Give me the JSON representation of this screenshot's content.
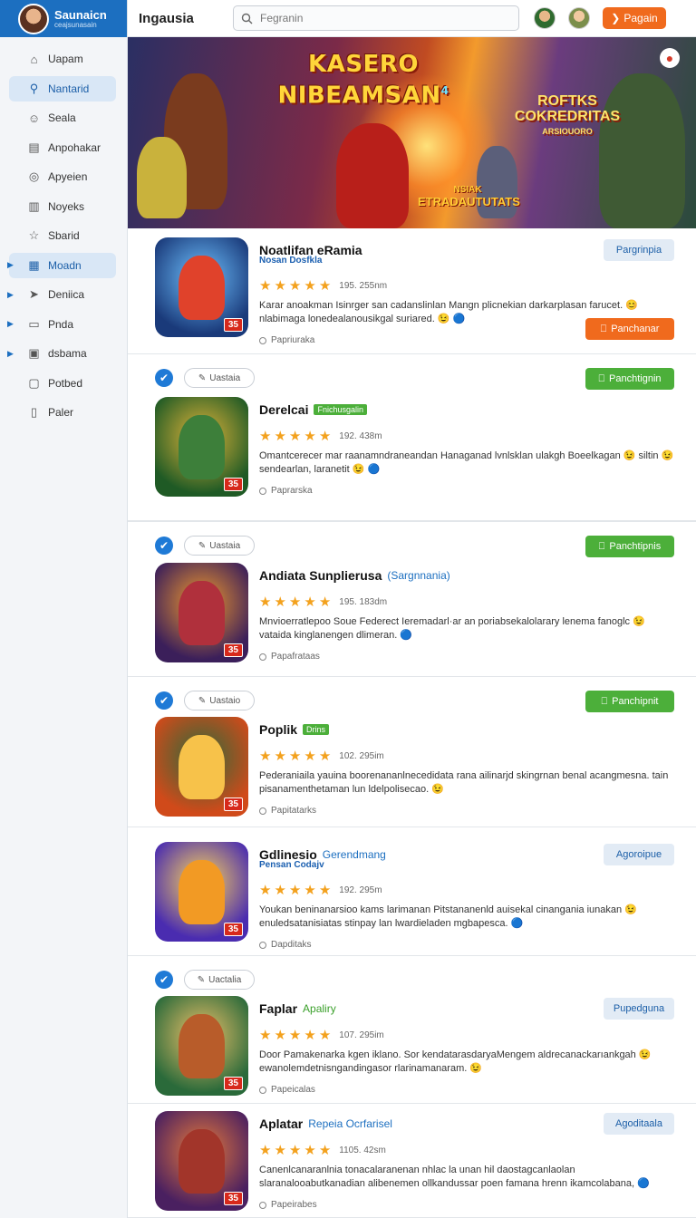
{
  "app": {
    "name": "Saunaicn",
    "subtitle": "ceajsunasain"
  },
  "header": {
    "title": "Ingausia",
    "search_placeholder": "Fegranin",
    "button": "Pagain"
  },
  "sidebar": {
    "items": [
      {
        "label": "Uapam",
        "icon": "home-icon",
        "active": false,
        "chev": false
      },
      {
        "label": "Nantarid",
        "icon": "search-icon",
        "active": true,
        "chev": false
      },
      {
        "label": "Seala",
        "icon": "user-icon",
        "active": false,
        "chev": false
      },
      {
        "label": "Anpohakar",
        "icon": "chart-icon",
        "active": false,
        "chev": false
      },
      {
        "label": "Apyeien",
        "icon": "circle-icon",
        "active": false,
        "chev": false
      },
      {
        "label": "Noyeks",
        "icon": "doc-icon",
        "active": false,
        "chev": false
      },
      {
        "label": "Sbarid",
        "icon": "star-icon",
        "active": false,
        "chev": false
      },
      {
        "label": "Moadn",
        "icon": "grid-icon",
        "active": true,
        "chev": true
      },
      {
        "label": "Deniica",
        "icon": "send-icon",
        "active": false,
        "chev": true
      },
      {
        "label": "Pnda",
        "icon": "box-icon",
        "active": false,
        "chev": true
      },
      {
        "label": "dsbama",
        "icon": "square-icon",
        "active": false,
        "chev": true
      },
      {
        "label": "Potbed",
        "icon": "folder-icon",
        "active": false,
        "chev": false
      },
      {
        "label": "Paler",
        "icon": "page-icon",
        "active": false,
        "chev": false
      }
    ]
  },
  "banner": {
    "title_line1": "KASERO",
    "title_line2": "NIBEAMSAN",
    "title_mark": "4",
    "subtitle_line1": "ROFTKS",
    "subtitle_line2": "COKREDRITAS",
    "subtitle_line3": "ARSIOUORO",
    "tag_line1": "NSIAK",
    "tag_line2": "ETRADAUTUTATS",
    "colors": {
      "title": "#ffd63a",
      "accent": "#f06a1d"
    }
  },
  "games": [
    {
      "title": "Noatlifan eRamia",
      "accent": "",
      "badge": "",
      "sub": "Nosan Dosfkla",
      "count": "195. 255nm",
      "desc": "Karar anoakman Isinrger san cadanslinlan Mangn plicnekian darkarplasan farucet. 😊 nlabimaga lonedealanousikgal suriared. 😉 🔵",
      "meta": "Papriuraka",
      "action": "Pargrinpia",
      "action2": "Panchanar",
      "checked": false,
      "tag": "",
      "thumb": "astra"
    },
    {
      "title": "Derelcai",
      "accent": "",
      "badge": "Fnichusgalin",
      "sub": "",
      "count": "192. 438m",
      "desc": "Omantcerecer mar raanamndraneandan Hanaganad lvnlsklan ulakgh Boeelkagan 😉 siltin 😉 sendearlan, laranetit 😉 🔵",
      "meta": "Paprarska",
      "action": "Panchtignin",
      "action2": "",
      "checked": true,
      "tag": "Uastaia",
      "thumb": "drara"
    },
    {
      "title": "Andiata Sunplierusa",
      "accent": "(Sargnnania)",
      "badge": "",
      "sub": "",
      "count": "195. 183dm",
      "desc": "Mnvioerratlepoo Soue Federect Ieremadarl·ar an poriabsekalolarary lenema fanoglc 😉 vataida kinglanengen dlimeran. 🔵",
      "meta": "Papafrataas",
      "action": "Panchtipnis",
      "action2": "",
      "checked": true,
      "tag": "Uastaia",
      "thumb": "hero3"
    },
    {
      "title": "Poplik",
      "accent": "",
      "badge": "Drins",
      "sub": "",
      "count": "102. 295im",
      "desc": "Pederaniaila yauina boorenananlnecedidata rana ailinarjd skingrnan benal acangmesna. tain pisanamenthetaman lun ldelpolisecao. 😉",
      "meta": "Papitatarks",
      "action": "Panchipnit",
      "action2": "",
      "checked": true,
      "tag": "Uastaio",
      "thumb": "poplik"
    },
    {
      "title": "Gdlinesio",
      "accent": "Gerendmang",
      "badge": "",
      "sub": "Pensan Codajv",
      "count": "192. 295m",
      "desc": "Youkan beninanarsioo kams larimanan Pitstananenld auisekal cinangania iunakan 😉 enuledsatanisiatas stinpay lan lwardieladen mgbapesca. 🔵",
      "meta": "Dapditaks",
      "action": "Agoroipue",
      "action2": "",
      "checked": false,
      "tag": "",
      "thumb": "fox"
    },
    {
      "title": "Faplar",
      "accent": "Apaliry",
      "badge": "",
      "sub": "",
      "count": "107. 295im",
      "desc": "Door Pamakenarka kgen iklano. Sor kendatarasdaryaMengem aldrecanackarıankgah 😉 ewanolemdetnisngandingasor rlarinamanaram. 😉",
      "meta": "Papeicalas",
      "action": "Pupedguna",
      "action2": "",
      "checked": true,
      "tag": "Uactalia",
      "thumb": "faplar"
    },
    {
      "title": "Aplatar",
      "accent": "Repeia Ocrfarisel",
      "badge": "",
      "sub": "",
      "count": "1105. 42sm",
      "desc": "Canenlcanaranlnia tonacalaranenan nhlac la unan hil daostagcanlaolan slaranalooabutkanadian alibenemen ollkandussar poen famana hrenn ikamcolabana, 🔵",
      "meta": "Papeirabes",
      "action": "Agoditaala",
      "action2": "",
      "checked": false,
      "tag": "",
      "thumb": "aplatar"
    }
  ]
}
